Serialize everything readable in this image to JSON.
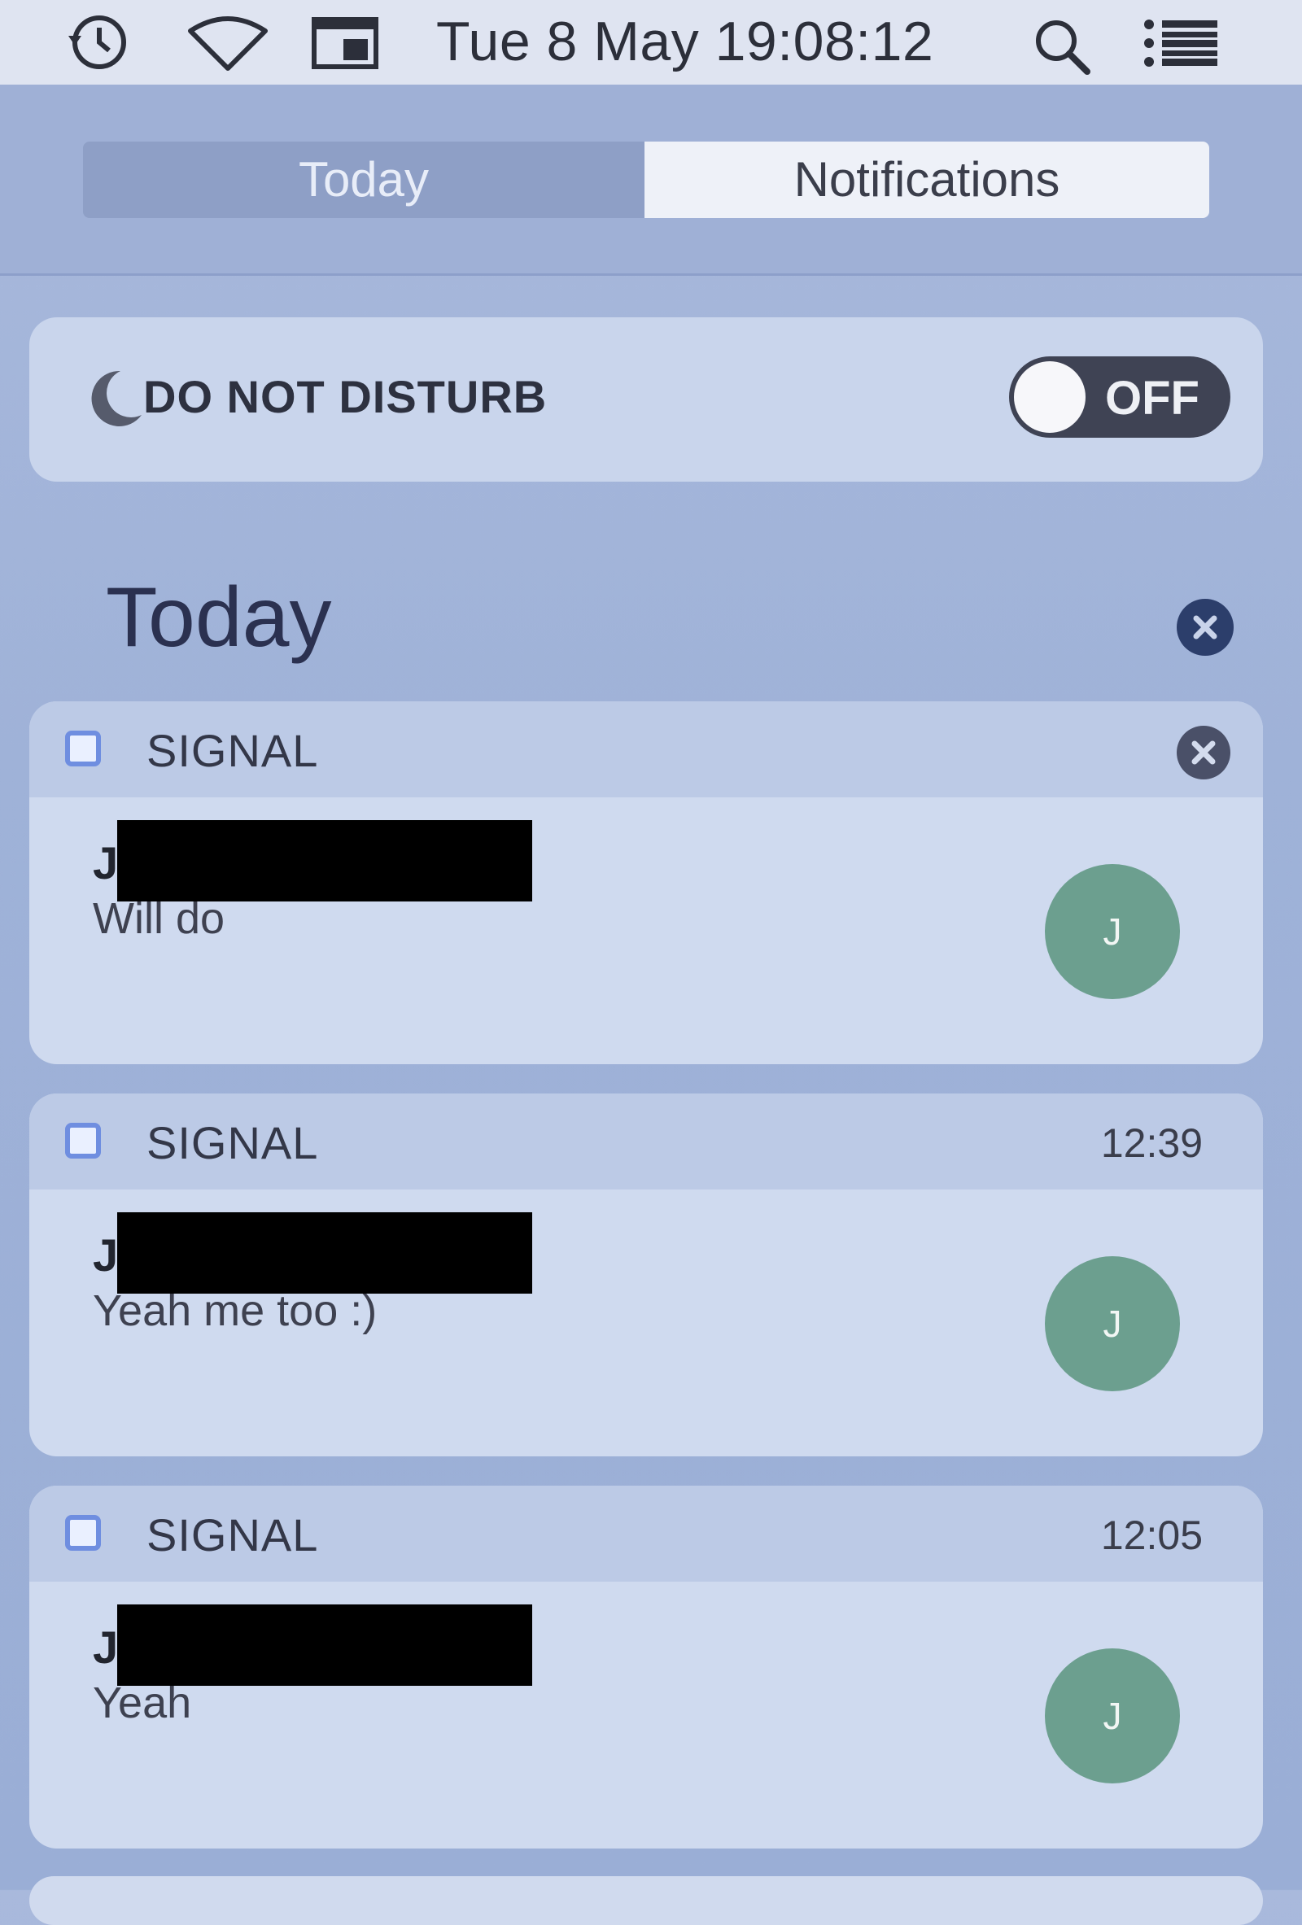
{
  "menubar": {
    "datetime": "Tue 8 May  19:08:12"
  },
  "tabs": [
    {
      "label": "Today"
    },
    {
      "label": "Notifications"
    }
  ],
  "dnd": {
    "label": "DO NOT DISTURB",
    "toggle_state": "OFF"
  },
  "section": {
    "title": "Today"
  },
  "notifications": [
    {
      "app": "SIGNAL",
      "time": "",
      "sender": "J",
      "message": "Will do",
      "avatar": "J"
    },
    {
      "app": "SIGNAL",
      "time": "12:39",
      "sender": "J",
      "message": "Yeah me too :)",
      "avatar": "J"
    },
    {
      "app": "SIGNAL",
      "time": "12:05",
      "sender": "J",
      "message": "Yeah",
      "avatar": "J"
    }
  ],
  "colors": {
    "toggle_bg": "#3f4354",
    "avatar_bg": "#6c9f8f",
    "app_icon": "#6f8ee0"
  }
}
